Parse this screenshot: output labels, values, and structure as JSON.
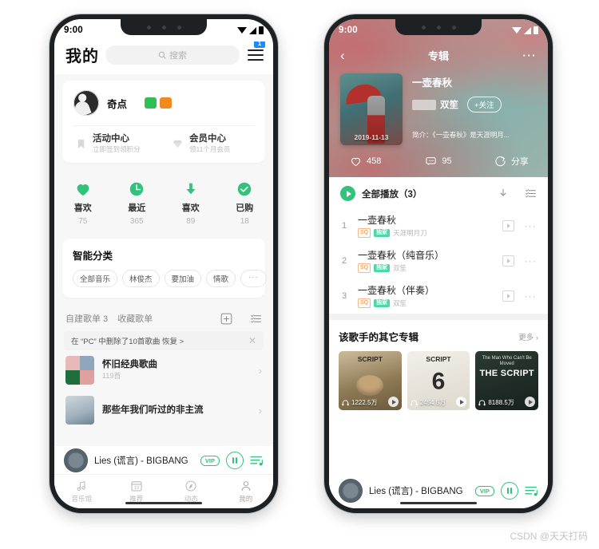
{
  "watermark": "CSDN @天天打码",
  "status": {
    "time": "9:00"
  },
  "left": {
    "header": {
      "title": "我的",
      "search_placeholder": "搜索",
      "menu_badge": "1"
    },
    "profile": {
      "name": "奇点"
    },
    "centers": [
      {
        "title": "活动中心",
        "subtitle": "立即签到领积分",
        "icon": "bookmark-icon"
      },
      {
        "title": "会员中心",
        "subtitle": "领11个月会员",
        "icon": "diamond-icon"
      }
    ],
    "stats": [
      {
        "label": "喜欢",
        "value": "75",
        "icon": "heart-icon"
      },
      {
        "label": "最近",
        "value": "365",
        "icon": "clock-icon"
      },
      {
        "label": "喜欢",
        "value": "89",
        "icon": "download-icon"
      },
      {
        "label": "已购",
        "value": "18",
        "icon": "check-circle-icon"
      }
    ],
    "smart": {
      "title": "智能分类",
      "tags": [
        "全部音乐",
        "林俊杰",
        "要加油",
        "情歌",
        "···"
      ]
    },
    "playlist_header": {
      "own": "自建歌单 3",
      "fav": "收藏歌单"
    },
    "notice": {
      "text": "在 “PC” 中删除了10首歌曲 恢复 >"
    },
    "playlists": [
      {
        "name": "怀旧经典歌曲",
        "count": "119首"
      },
      {
        "name": "那些年我们听过的非主流",
        "count": ""
      }
    ],
    "tabs": [
      {
        "label": "音乐馆",
        "icon": "music-note-icon"
      },
      {
        "label": "推荐",
        "icon": "calendar-icon",
        "day": "13"
      },
      {
        "label": "动态",
        "icon": "compass-icon"
      },
      {
        "label": "我的",
        "icon": "person-icon"
      }
    ]
  },
  "right": {
    "topbar": {
      "title": "专辑",
      "back_icon": "chevron-left-icon",
      "more_icon": "more-horizontal-icon"
    },
    "album": {
      "cover_date": "2019-11-13",
      "title": "一壶春秋",
      "artist": "双笙",
      "follow_label": "+关注",
      "description": "简介：《一壶春秋》是天涯明月..."
    },
    "actions": [
      {
        "label": "458",
        "icon": "heart-outline-icon"
      },
      {
        "label": "95",
        "icon": "comment-icon"
      },
      {
        "label": "分享",
        "icon": "share-icon"
      }
    ],
    "playall": {
      "label": "全部播放（3）",
      "download_icon": "download-icon",
      "list_icon": "playlist-icon"
    },
    "songs": [
      {
        "index": "1",
        "name": "一壶春秋",
        "badges": [
          "SQ",
          "独家"
        ],
        "artist": "天涯明月刀"
      },
      {
        "index": "2",
        "name": "一壶春秋（纯音乐）",
        "badges": [
          "SQ",
          "独家"
        ],
        "artist": "双笙"
      },
      {
        "index": "3",
        "name": "一壶春秋（伴奏）",
        "badges": [
          "SQ",
          "独家"
        ],
        "artist": "双笙"
      }
    ],
    "other": {
      "title": "该歌手的其它专辑",
      "more": "更多 ›",
      "albums": [
        {
          "caption": "SCRIPT",
          "plays": "1222.5万"
        },
        {
          "caption": "SCRIPT",
          "plays": "2454.5万"
        },
        {
          "caption": "THE SCRIPT",
          "subcaption": "The Man Who Can't Be Moved",
          "plays": "8188.5万"
        }
      ]
    }
  },
  "mini_player": {
    "title": "Lies (谎言) - BIGBANG",
    "vip": "VIP",
    "pause_icon": "pause-icon",
    "queue_icon": "queue-icon"
  },
  "colors": {
    "accent_green": "#31c27c",
    "badge_blue": "#1a8cff",
    "badge_orange": "#f0a868"
  }
}
